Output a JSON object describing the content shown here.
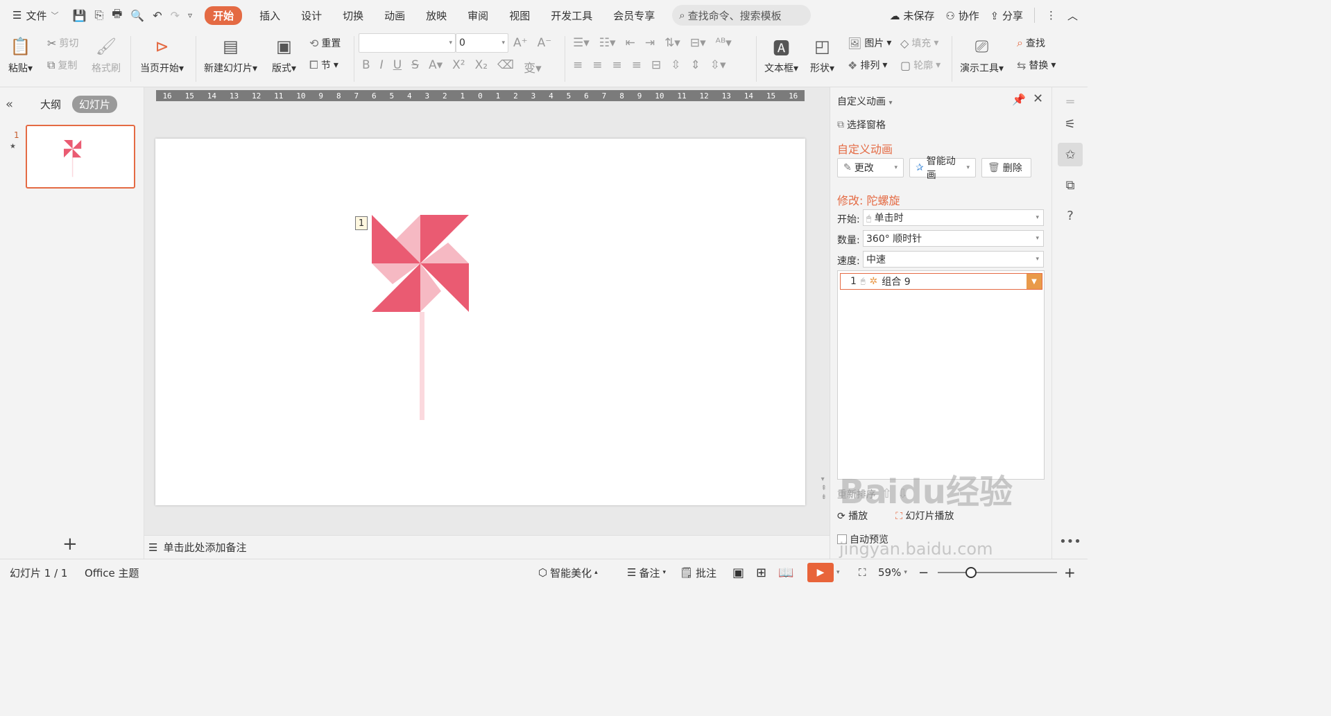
{
  "menubar": {
    "file_label": "文件",
    "tabs": [
      "开始",
      "插入",
      "设计",
      "切换",
      "动画",
      "放映",
      "审阅",
      "视图",
      "开发工具",
      "会员专享"
    ],
    "search_placeholder": "查找命令、搜索模板",
    "unsaved": "未保存",
    "collab": "协作",
    "share": "分享"
  },
  "ribbon": {
    "paste": "粘贴",
    "cut": "剪切",
    "copy": "复制",
    "format_painter": "格式刷",
    "from_current": "当页开始",
    "new_slide": "新建幻灯片",
    "layout": "版式",
    "reset": "重置",
    "section": "节",
    "font_size_value": "0",
    "textbox": "文本框",
    "shape": "形状",
    "picture": "图片",
    "fill": "填充",
    "arrange": "排列",
    "outline": "轮廓",
    "presentation_tool": "演示工具",
    "find": "查找",
    "replace": "替换"
  },
  "left_panel": {
    "tab_outline": "大纲",
    "tab_slides": "幻灯片",
    "slide_number": "1"
  },
  "ruler_ticks": [
    "16",
    "15",
    "14",
    "13",
    "12",
    "11",
    "10",
    "9",
    "8",
    "7",
    "6",
    "5",
    "4",
    "3",
    "2",
    "1",
    "0",
    "1",
    "2",
    "3",
    "4",
    "5",
    "6",
    "7",
    "8",
    "9",
    "10",
    "11",
    "12",
    "13",
    "14",
    "15",
    "16"
  ],
  "slide": {
    "anim_tag": "1"
  },
  "notes": {
    "placeholder": "单击此处添加备注"
  },
  "pane": {
    "title": "自定义动画",
    "select_pane": "选择窗格",
    "heading": "自定义动画",
    "change": "更改",
    "smart_anim": "智能动画",
    "delete": "删除",
    "modify": "修改: 陀螺旋",
    "start_label": "开始:",
    "start_value": "单击时",
    "amount_label": "数量:",
    "amount_value": "360° 顺时针",
    "speed_label": "速度:",
    "speed_value": "中速",
    "anim_item_index": "1",
    "anim_item_name": "组合 9",
    "reorder": "重新排序",
    "play": "播放",
    "slideshow": "幻灯片播放",
    "auto_preview": "自动预览"
  },
  "watermark": {
    "line1": "Baidu经验",
    "line2": "jingyan.baidu.com"
  },
  "status": {
    "slide_count": "幻灯片 1 / 1",
    "theme": "Office 主题",
    "beautify": "智能美化",
    "notes": "备注",
    "comment": "批注",
    "zoom": "59%"
  },
  "colors": {
    "accent": "#e46a43",
    "pinwheel_dark": "#ea5b72",
    "pinwheel_light": "#f6b9c3",
    "stick": "#fbd9de"
  }
}
